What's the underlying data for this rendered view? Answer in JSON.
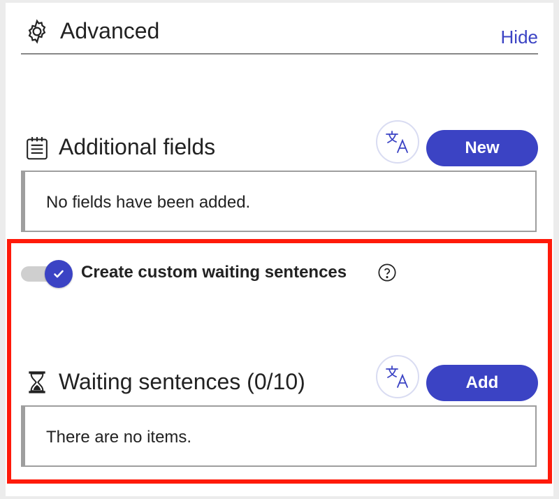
{
  "advanced": {
    "title": "Advanced",
    "icon": "gear-icon",
    "hide_label": "Hide",
    "link_color": "#3b43c4"
  },
  "additional_fields": {
    "title": "Additional fields",
    "icon": "calendar-list-icon",
    "translate_icon": "translate-icon",
    "new_label": "New",
    "empty_text": "No fields have been added."
  },
  "waiting": {
    "toggle_label": "Create custom waiting sentences",
    "toggle_on": true,
    "help_icon": "question-circle-icon",
    "title": "Waiting sentences (0/10)",
    "icon": "hourglass-icon",
    "translate_icon": "translate-icon",
    "add_label": "Add",
    "empty_text": "There are no items."
  },
  "colors": {
    "accent": "#3b43c4",
    "highlight": "#ff1a0a",
    "toggle_track": "#cfcfcf"
  }
}
